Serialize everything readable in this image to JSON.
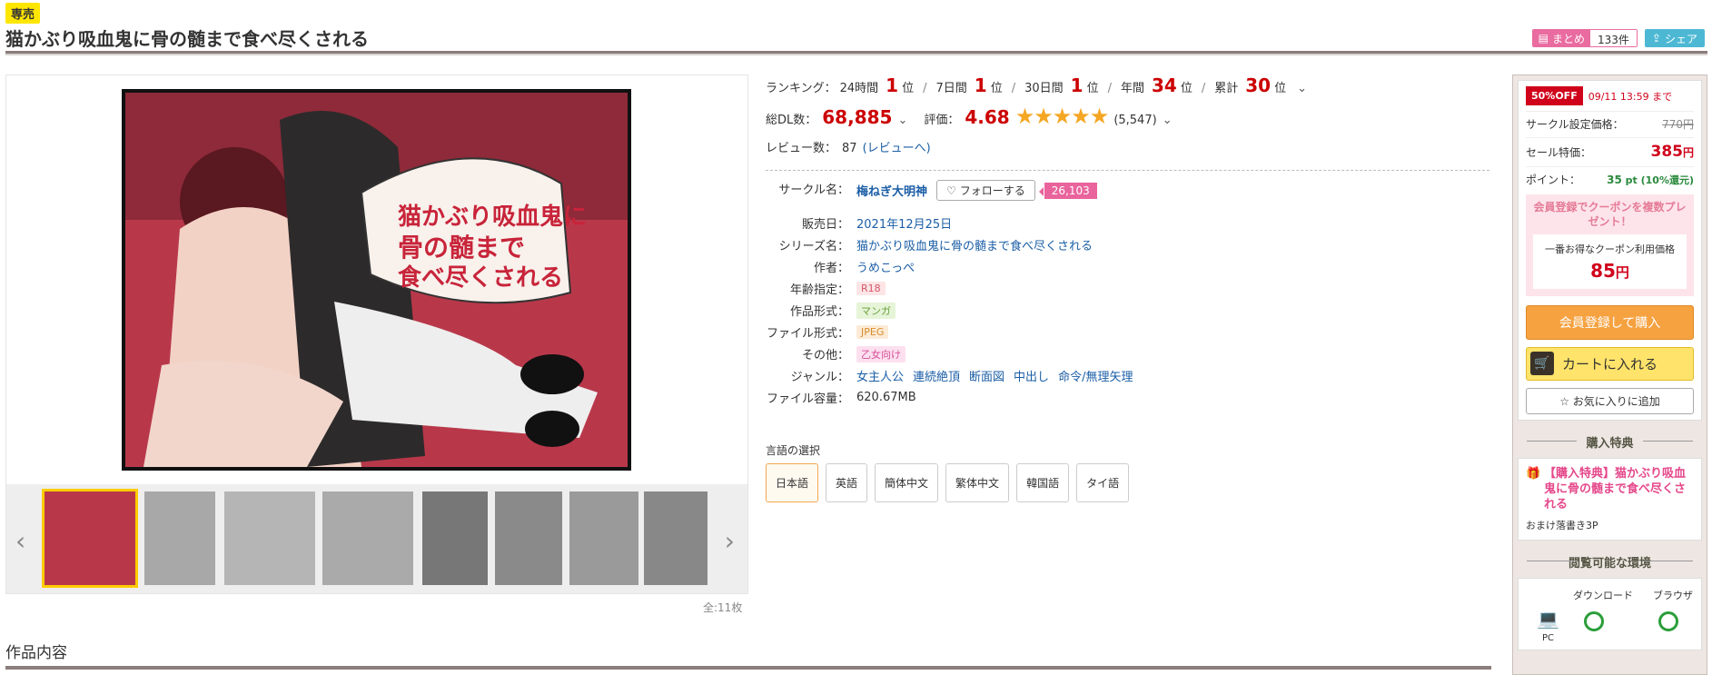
{
  "header": {
    "badge": "専売",
    "title": "猫かぶり吸血鬼に骨の髄まで食べ尽くされる",
    "matome_label": "まとめ",
    "matome_count": "133件",
    "share_label": "シェア"
  },
  "gallery": {
    "count_label": "全:11枚",
    "cover_title_lines": [
      "猫かぶり吸血鬼に",
      "骨の髄まで",
      "食べ尽くされる"
    ]
  },
  "ranking": {
    "label": "ランキング：",
    "items": [
      {
        "period": "24時間",
        "value": "1",
        "unit": "位"
      },
      {
        "period": "7日間",
        "value": "1",
        "unit": "位"
      },
      {
        "period": "30日間",
        "value": "1",
        "unit": "位"
      },
      {
        "period": "年間",
        "value": "34",
        "unit": "位"
      },
      {
        "period": "累計",
        "value": "30",
        "unit": "位"
      }
    ]
  },
  "stats": {
    "dl_label": "総DL数：",
    "dl_value": "68,885",
    "rating_label": "評価：",
    "rating_value": "4.68",
    "rating_count": "(5,547)",
    "review_label": "レビュー数：",
    "review_count": "87",
    "review_link": "(レビューへ)"
  },
  "circle": {
    "label": "サークル名：",
    "name": "梅ねぎ大明神",
    "follow_label": "フォローする",
    "follower_count": "26,103"
  },
  "spec": {
    "release_label": "販売日：",
    "release_value": "2021年12月25日",
    "series_label": "シリーズ名：",
    "series_value": "猫かぶり吸血鬼に骨の髄まで食べ尽くされる",
    "author_label": "作者：",
    "author_value": "うめこっぺ",
    "age_label": "年齢指定：",
    "age_value": "R18",
    "type_label": "作品形式：",
    "type_value": "マンガ",
    "file_label": "ファイル形式：",
    "file_value": "JPEG",
    "other_label": "その他：",
    "other_value": "乙女向け",
    "genre_label": "ジャンル：",
    "genres": [
      "女主人公",
      "連続絶頂",
      "断面図",
      "中出し",
      "命令/無理矢理"
    ],
    "size_label": "ファイル容量：",
    "size_value": "620.67MB"
  },
  "language": {
    "label": "言語の選択",
    "options": [
      "日本語",
      "英語",
      "簡体中文",
      "繁体中文",
      "韓国語",
      "タイ語"
    ],
    "selected": "日本語"
  },
  "purchase": {
    "off_badge": "50%OFF",
    "off_deadline": "09/11 13:59 まで",
    "circle_price_label": "サークル設定価格：",
    "circle_price": "770円",
    "sale_price_label": "セール特価：",
    "sale_price": "385",
    "sale_price_unit": "円",
    "point_label": "ポイント：",
    "point_value": "35",
    "point_unit": "pt (10%還元)",
    "coupon_title": "会員登録でクーポンを複数プレゼント！",
    "coupon_sub": "一番お得なクーポン利用価格",
    "coupon_price": "85",
    "coupon_unit": "円",
    "register_label": "会員登録して購入",
    "cart_label": "カートに入れる",
    "favorite_label": "お気に入りに追加"
  },
  "bonus": {
    "heading": "購入特典",
    "title": "【購入特典】猫かぶり吸血鬼に骨の髄まで食べ尽くされる",
    "desc": "おまけ落書き3P"
  },
  "environment": {
    "heading": "閲覧可能な環境",
    "col_download": "ダウンロード",
    "col_browser": "ブラウザ",
    "row_pc": "PC"
  },
  "content": {
    "heading": "作品内容"
  },
  "colors": {
    "accent_red": "#c00000",
    "star": "#f5a623",
    "pink": "#e9649d"
  }
}
